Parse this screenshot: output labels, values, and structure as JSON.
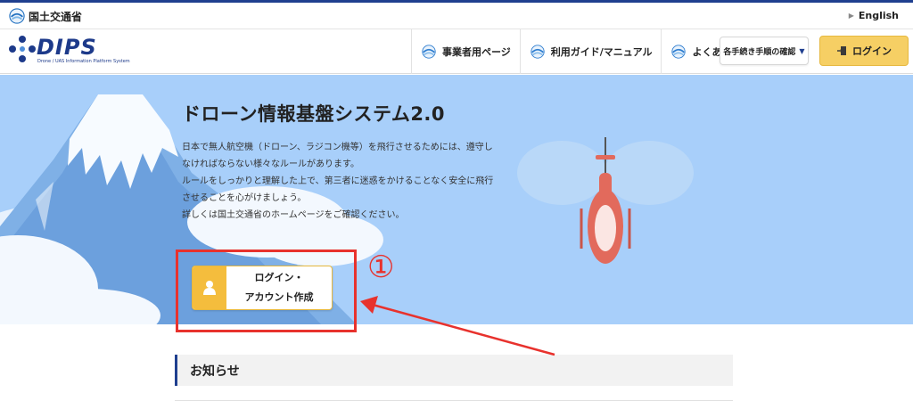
{
  "topbar": {
    "ministry_name": "国土交通省",
    "english_link": "English"
  },
  "header": {
    "logo_text": "DIPS",
    "logo_subtext": "Drone / UAS Information Platform System",
    "nav": [
      {
        "label": "事業者用ページ"
      },
      {
        "label": "利用ガイド/マニュアル"
      },
      {
        "label": "よくある質問"
      }
    ],
    "procedure_dropdown": "各手続き手順の確認",
    "login_button": "ログイン"
  },
  "hero": {
    "title": "ドローン情報基盤システム2.0",
    "paragraphs": [
      "日本で無人航空機（ドローン、ラジコン機等）を飛行させるためには、遵守し",
      "なければならない様々なルールがあります。",
      "ルールをしっかりと理解した上で、第三者に迷惑をかけることなく安全に飛行",
      "させることを心がけましょう。",
      "詳しくは国土交通省のホームページをご確認ください。"
    ],
    "cta_label": "ログイン・\nアカウント作成"
  },
  "annotation": {
    "marker": "①",
    "color": "#e8322d"
  },
  "news": {
    "heading": "お知らせ"
  },
  "colors": {
    "brand_navy": "#1f3f8f",
    "accent_yellow": "#f6cf64",
    "hero_sky": "#a8cffa"
  }
}
